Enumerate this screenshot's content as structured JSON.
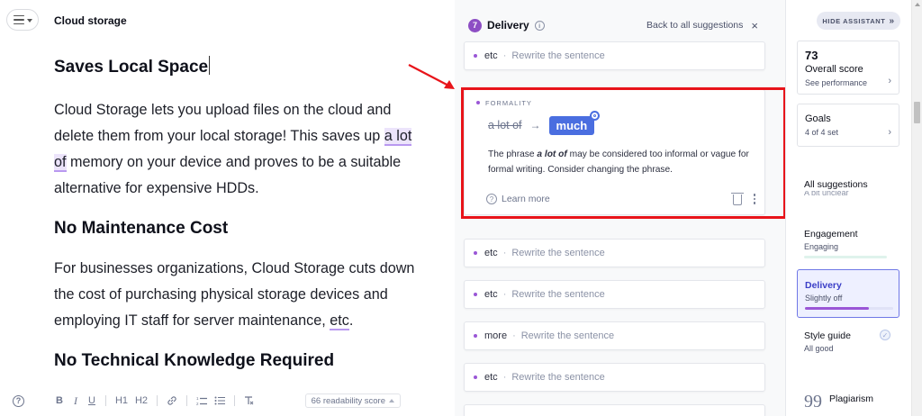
{
  "editor": {
    "doc_title": "Cloud storage",
    "sections": [
      {
        "heading": "Saves Local Space",
        "paragraph": {
          "before": "Cloud Storage lets you upload files on the cloud and delete them from your local storage! This saves up ",
          "highlight": "a lot of",
          "after": " memory on your device and proves to be a suitable alternative for expensive HDDs."
        }
      },
      {
        "heading": "No Maintenance Cost",
        "paragraph": {
          "before": "For businesses organizations, Cloud Storage cuts down the cost of purchasing physical storage devices and employing IT staff for server maintenance, ",
          "underline": "etc",
          "after": "."
        }
      },
      {
        "heading": "No Technical Knowledge Required"
      }
    ],
    "toolbar": {
      "help": "?",
      "bold": "B",
      "italic": "I",
      "underline": "U",
      "h1": "H1",
      "h2": "H2",
      "readability": "66 readability score"
    }
  },
  "suggestions": {
    "count": "7",
    "title": "Delivery",
    "back_link": "Back to all suggestions",
    "close": "×",
    "separator": "·",
    "mini_cards": [
      {
        "word": "etc",
        "action": "Rewrite the sentence"
      },
      {
        "word": "etc",
        "action": "Rewrite the sentence"
      },
      {
        "word": "etc",
        "action": "Rewrite the sentence"
      },
      {
        "word": "more",
        "action": "Rewrite the sentence"
      },
      {
        "word": "etc",
        "action": "Rewrite the sentence"
      }
    ],
    "expanded": {
      "category": "FORMALITY",
      "original": "a lot of",
      "arrow": "→",
      "replacement": "much",
      "explain_before": "The phrase ",
      "explain_phrase": "a lot of",
      "explain_after": " may be considered too informal or vague for formal writing. Consider changing the phrase.",
      "learn_more": "Learn more"
    }
  },
  "assistant": {
    "hide_button": "HIDE ASSISTANT",
    "hide_chevron": "»",
    "overall": {
      "score": "73",
      "label": "Overall score",
      "sub": "See performance"
    },
    "goals": {
      "label": "Goals",
      "sub": "4 of 4 set"
    },
    "chevron": "›",
    "all_suggestions": "All suggestions",
    "all_suggestions_sub": "A bit unclear",
    "engagement": {
      "name": "Engagement",
      "sub": "Engaging"
    },
    "delivery": {
      "name": "Delivery",
      "sub": "Slightly off",
      "level": 0.72
    },
    "style_guide": {
      "name": "Style guide",
      "sub": "All good"
    },
    "check": "✓",
    "plagiarism": "Plagiarism",
    "quote": "99"
  },
  "colors": {
    "accent_purple": "#9a56d6",
    "replacement_blue": "#4a6ee0",
    "delivery_active": "#3b3fc7",
    "annotation_red": "#e8141a"
  }
}
